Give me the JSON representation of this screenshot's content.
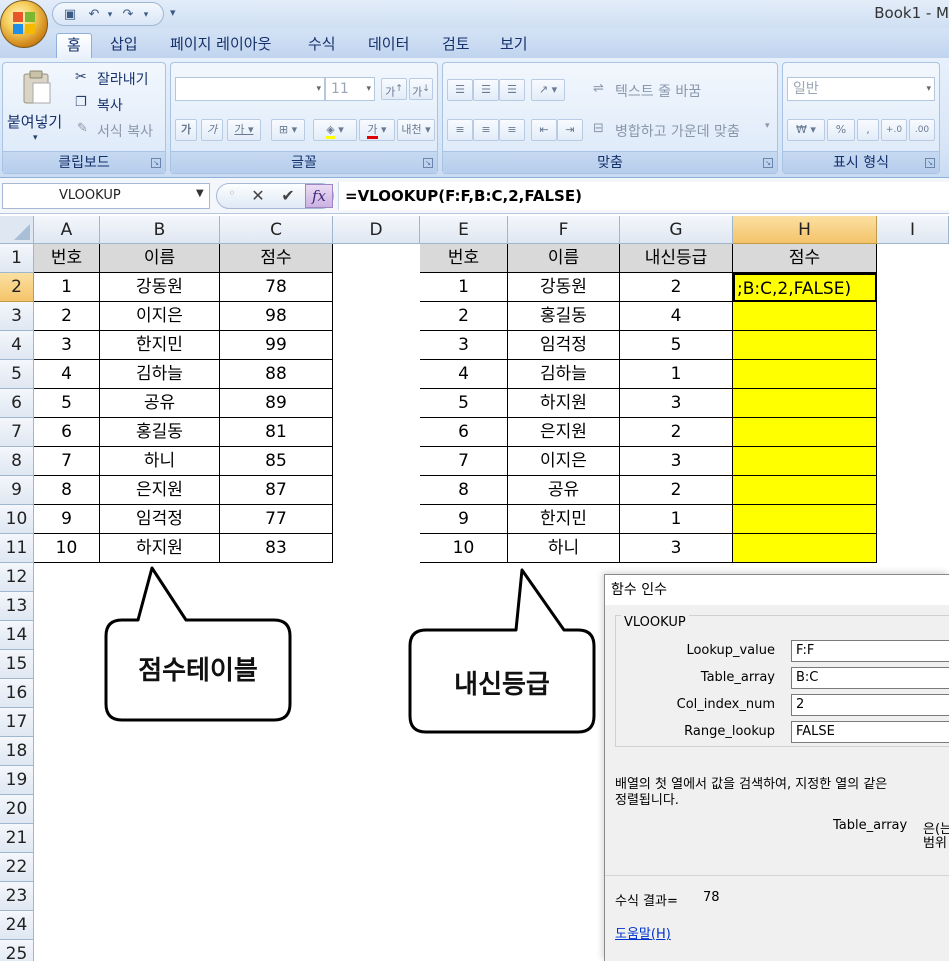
{
  "window": {
    "title": "Book1 - M"
  },
  "ribbon": {
    "tabs": [
      "홈",
      "삽입",
      "페이지 레이아웃",
      "수식",
      "데이터",
      "검토",
      "보기"
    ],
    "clipboard": {
      "paste": "붙여넣기",
      "cut": "잘라내기",
      "copy": "복사",
      "format_painter": "서식 복사",
      "label": "클립보드"
    },
    "font": {
      "size": "11",
      "label": "글꼴"
    },
    "alignment": {
      "wrap_text": "텍스트 줄 바꿈",
      "merge_center": "병합하고 가운데 맞춤",
      "label": "맞춤"
    },
    "number": {
      "format": "일반",
      "label": "표시 형식"
    }
  },
  "formula_bar": {
    "name_box": "VLOOKUP",
    "formula": "=VLOOKUP(F:F,B:C,2,FALSE)"
  },
  "columns": [
    "A",
    "B",
    "C",
    "D",
    "E",
    "F",
    "G",
    "H",
    "I"
  ],
  "rows": [
    "1",
    "2",
    "3",
    "4",
    "5",
    "6",
    "7",
    "8",
    "9",
    "10",
    "11",
    "12",
    "13",
    "14",
    "15",
    "16",
    "17",
    "18",
    "19",
    "20",
    "21",
    "22",
    "23",
    "24",
    "25"
  ],
  "table1": {
    "headers": [
      "번호",
      "이름",
      "점수"
    ],
    "rows": [
      [
        "1",
        "강동원",
        "78"
      ],
      [
        "2",
        "이지은",
        "98"
      ],
      [
        "3",
        "한지민",
        "99"
      ],
      [
        "4",
        "김하늘",
        "88"
      ],
      [
        "5",
        "공유",
        "89"
      ],
      [
        "6",
        "홍길동",
        "81"
      ],
      [
        "7",
        "하니",
        "85"
      ],
      [
        "8",
        "은지원",
        "87"
      ],
      [
        "9",
        "임걱정",
        "77"
      ],
      [
        "10",
        "하지원",
        "83"
      ]
    ]
  },
  "table2": {
    "headers": [
      "번호",
      "이름",
      "내신등급",
      "점수"
    ],
    "rows": [
      [
        "1",
        "강동원",
        "2"
      ],
      [
        "2",
        "홍길동",
        "4"
      ],
      [
        "3",
        "임걱정",
        "5"
      ],
      [
        "4",
        "김하늘",
        "1"
      ],
      [
        "5",
        "하지원",
        "3"
      ],
      [
        "6",
        "은지원",
        "2"
      ],
      [
        "7",
        "이지은",
        "3"
      ],
      [
        "8",
        "공유",
        "2"
      ],
      [
        "9",
        "한지민",
        "1"
      ],
      [
        "10",
        "하니",
        "3"
      ]
    ],
    "editing_cell": ";B:C,2,FALSE)"
  },
  "callouts": {
    "left": "점수테이블",
    "right": "내신등급"
  },
  "dialog": {
    "title": "함수 인수",
    "function": "VLOOKUP",
    "args": [
      {
        "label": "Lookup_value",
        "value": "F:F"
      },
      {
        "label": "Table_array",
        "value": "B:C"
      },
      {
        "label": "Col_index_num",
        "value": "2"
      },
      {
        "label": "Range_lookup",
        "value": "FALSE"
      }
    ],
    "description_line1": "배열의 첫 열에서 값을 검색하여, 지정한 열의 같은",
    "description_line2": "정렬됩니다.",
    "arg_name": "Table_array",
    "arg_desc1": "은(는",
    "arg_desc2": "범위",
    "result_label": "수식 결과=",
    "result_value": "78",
    "help": "도움말(H)"
  }
}
